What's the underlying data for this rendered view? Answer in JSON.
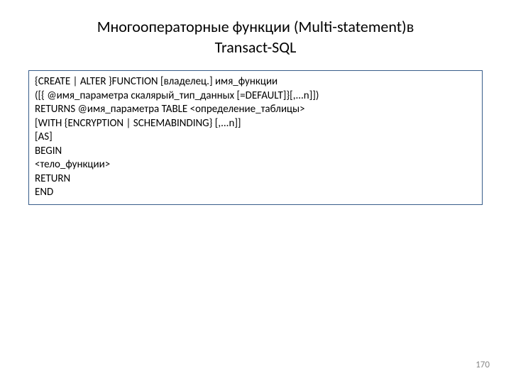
{
  "title_line1": "Многооператорные функции (Multi-statement)в",
  "title_line2": "Transact-SQL",
  "code": {
    "line1": "{CREATE | ALTER }FUNCTION [владелец.] имя_функции",
    "line2": "([{ @имя_параметра скалярый_тип_данных [=DEFAULT]}[,...n]])",
    "line3": "RETURNS @имя_параметра TABLE  <определение_таблицы>",
    "line4": "[WITH {ENCRYPTION | SCHEMABINDING} [,...n]]",
    "line5": "[AS]",
    "line6": "BEGIN",
    "line7": "<тело_функции>",
    "line8": "RETURN",
    "line9": "END"
  },
  "page_number": "170"
}
